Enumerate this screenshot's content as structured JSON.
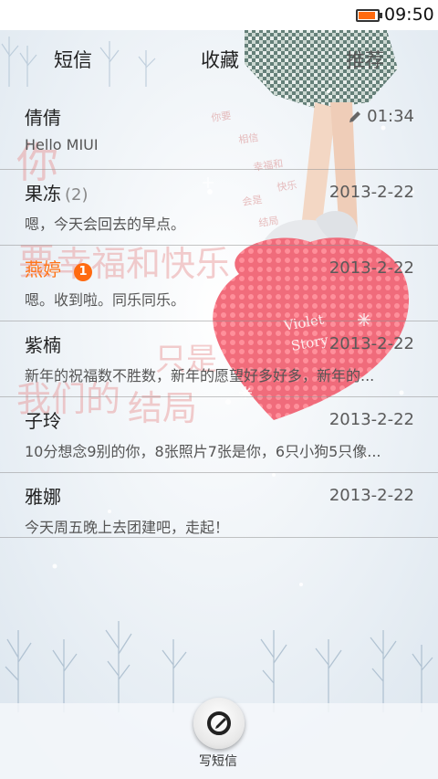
{
  "status_bar": {
    "time": "09:50",
    "battery_level": 0.9,
    "battery_color": "#ff6a10"
  },
  "tabs": [
    {
      "label": "短信"
    },
    {
      "label": "收藏"
    },
    {
      "label": "推荐"
    }
  ],
  "conversations": [
    {
      "name": "倩倩",
      "count": "",
      "time": "01:34",
      "preview": "Hello MIUI",
      "draft": true,
      "unread": ""
    },
    {
      "name": "果冻",
      "count": "(2)",
      "time": "2013-2-22",
      "preview": "嗯，今天会回去的早点。",
      "draft": false,
      "unread": ""
    },
    {
      "name": "燕婷",
      "count": "",
      "time": "2013-2-22",
      "preview": "嗯。收到啦。同乐同乐。",
      "draft": false,
      "unread": "1"
    },
    {
      "name": "紫楠",
      "count": "",
      "time": "2013-2-22",
      "preview": "新年的祝福数不胜数，新年的愿望好多好多，新年的...",
      "draft": false,
      "unread": ""
    },
    {
      "name": "子玲",
      "count": "",
      "time": "2013-2-22",
      "preview": "10分想念9别的你，8张照片7张是你，6只小狗5只像...",
      "draft": false,
      "unread": ""
    },
    {
      "name": "雅娜",
      "count": "",
      "time": "2013-2-22",
      "preview": "今天周五晚上去团建吧，走起！",
      "draft": false,
      "unread": ""
    }
  ],
  "compose": {
    "label": "写短信"
  },
  "theme": {
    "accent": "#ff7418",
    "divider": "#9a9a9a"
  }
}
